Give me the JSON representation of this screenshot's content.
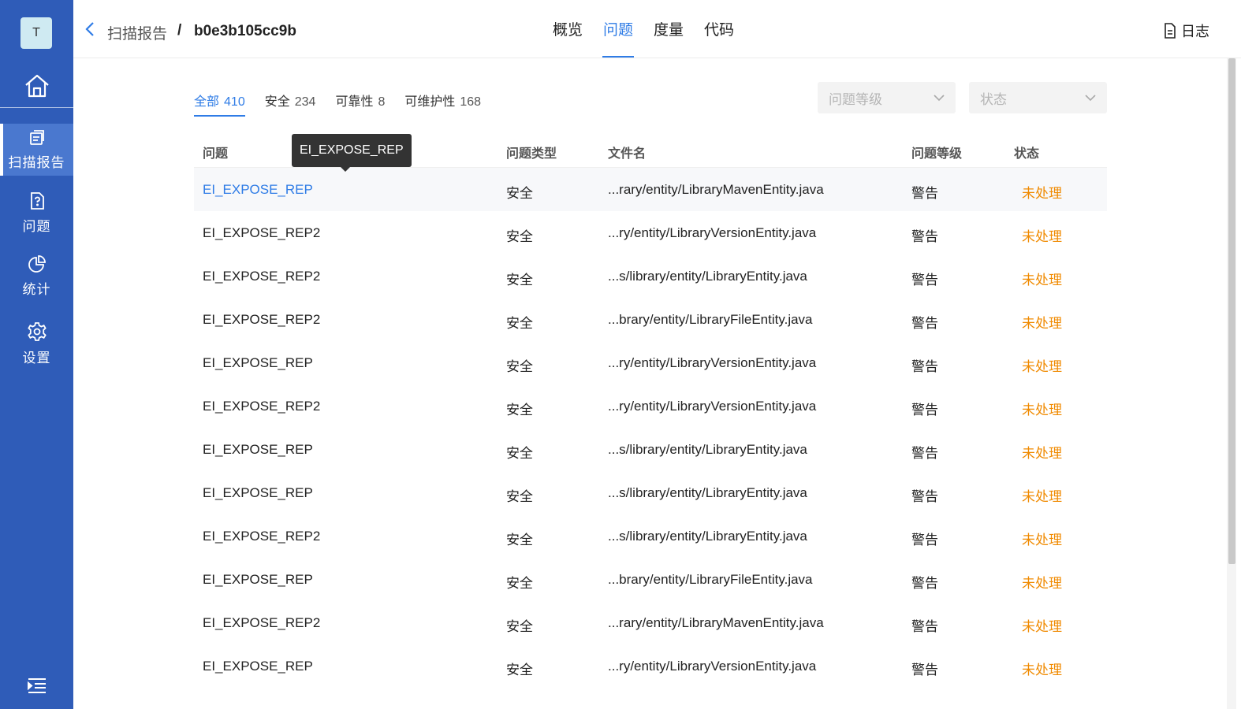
{
  "sidebar": {
    "avatar": "T",
    "items": [
      {
        "label": "扫描报告",
        "icon": "report-icon"
      },
      {
        "label": "问题",
        "icon": "issue-file-icon"
      },
      {
        "label": "统计",
        "icon": "pie-chart-icon"
      },
      {
        "label": "设置",
        "icon": "gear-icon"
      }
    ]
  },
  "header": {
    "breadcrumb_parent": "扫描报告",
    "breadcrumb_sep": "/",
    "breadcrumb_current": "b0e3b105cc9b",
    "tabs": [
      "概览",
      "问题",
      "度量",
      "代码"
    ],
    "active_tab": "问题",
    "log_label": "日志"
  },
  "filters": {
    "tabs": [
      {
        "label": "全部",
        "count": "410"
      },
      {
        "label": "安全",
        "count": "234"
      },
      {
        "label": "可靠性",
        "count": "8"
      },
      {
        "label": "可维护性",
        "count": "168"
      }
    ],
    "level_placeholder": "问题等级",
    "status_placeholder": "状态"
  },
  "table": {
    "columns": [
      "问题",
      "问题类型",
      "文件名",
      "问题等级",
      "状态"
    ],
    "rows": [
      {
        "issue": "EI_EXPOSE_REP",
        "type": "安全",
        "file": "...rary/entity/LibraryMavenEntity.java",
        "level": "警告",
        "status": "未处理"
      },
      {
        "issue": "EI_EXPOSE_REP2",
        "type": "安全",
        "file": "...ry/entity/LibraryVersionEntity.java",
        "level": "警告",
        "status": "未处理"
      },
      {
        "issue": "EI_EXPOSE_REP2",
        "type": "安全",
        "file": "...s/library/entity/LibraryEntity.java",
        "level": "警告",
        "status": "未处理"
      },
      {
        "issue": "EI_EXPOSE_REP2",
        "type": "安全",
        "file": "...brary/entity/LibraryFileEntity.java",
        "level": "警告",
        "status": "未处理"
      },
      {
        "issue": "EI_EXPOSE_REP",
        "type": "安全",
        "file": "...ry/entity/LibraryVersionEntity.java",
        "level": "警告",
        "status": "未处理"
      },
      {
        "issue": "EI_EXPOSE_REP2",
        "type": "安全",
        "file": "...ry/entity/LibraryVersionEntity.java",
        "level": "警告",
        "status": "未处理"
      },
      {
        "issue": "EI_EXPOSE_REP",
        "type": "安全",
        "file": "...s/library/entity/LibraryEntity.java",
        "level": "警告",
        "status": "未处理"
      },
      {
        "issue": "EI_EXPOSE_REP",
        "type": "安全",
        "file": "...s/library/entity/LibraryEntity.java",
        "level": "警告",
        "status": "未处理"
      },
      {
        "issue": "EI_EXPOSE_REP2",
        "type": "安全",
        "file": "...s/library/entity/LibraryEntity.java",
        "level": "警告",
        "status": "未处理"
      },
      {
        "issue": "EI_EXPOSE_REP",
        "type": "安全",
        "file": "...brary/entity/LibraryFileEntity.java",
        "level": "警告",
        "status": "未处理"
      },
      {
        "issue": "EI_EXPOSE_REP2",
        "type": "安全",
        "file": "...rary/entity/LibraryMavenEntity.java",
        "level": "警告",
        "status": "未处理"
      },
      {
        "issue": "EI_EXPOSE_REP",
        "type": "安全",
        "file": "...ry/entity/LibraryVersionEntity.java",
        "level": "警告",
        "status": "未处理"
      }
    ]
  },
  "tooltip": "EI_EXPOSE_REP",
  "colors": {
    "sidebar": "#2f5cb8",
    "accent": "#2f7ce6",
    "status_pending": "#f08a00"
  }
}
